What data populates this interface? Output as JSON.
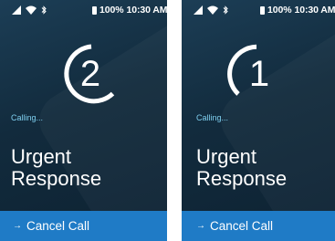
{
  "screens": [
    {
      "status": {
        "battery": "100%",
        "time": "10:30 AM"
      },
      "countdown": "2",
      "calling_text": "Calling...",
      "title_line1": "Urgent",
      "title_line2": "Response",
      "cancel_label": "Cancel Call",
      "cancel_arrow": "→"
    },
    {
      "status": {
        "battery": "100%",
        "time": "10:30 AM"
      },
      "countdown": "1",
      "calling_text": "Calling...",
      "title_line1": "Urgent",
      "title_line2": "Response",
      "cancel_label": "Cancel Call",
      "cancel_arrow": "→"
    }
  ],
  "colors": {
    "background": "#122b3d",
    "accent": "#1f7bc6",
    "calling_text": "#7fd0f0"
  },
  "icons": [
    "signal-icon",
    "wifi-icon",
    "bluetooth-icon",
    "battery-icon",
    "countdown-ring-icon",
    "arrow-right-icon"
  ]
}
